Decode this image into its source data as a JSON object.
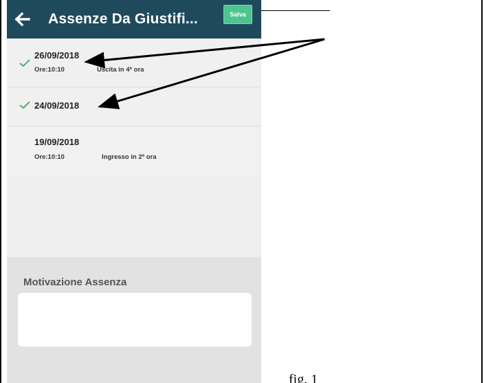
{
  "header": {
    "title": "Assenze Da Giustifi...",
    "save_label": "Salva",
    "background": "#1f4a5c",
    "save_color": "#4ec48f"
  },
  "absences": [
    {
      "date": "26/09/2018",
      "time": "Ore:10:10",
      "note": "Uscita in 4ª ora",
      "checked": true
    },
    {
      "date": "24/09/2018",
      "time": "",
      "note": "",
      "checked": true
    },
    {
      "date": "19/09/2018",
      "time": "Ore:10:10",
      "note": "Ingresso in 2ª ora",
      "checked": false
    }
  ],
  "motivation": {
    "label": "Motivazione Assenza",
    "value": "",
    "placeholder": ""
  },
  "caption": "fig. 1",
  "colors": {
    "check": "#5aa86e",
    "annotation_arrow": "#000000"
  },
  "icons": {
    "back": "arrow-left-icon",
    "check": "check-icon"
  }
}
